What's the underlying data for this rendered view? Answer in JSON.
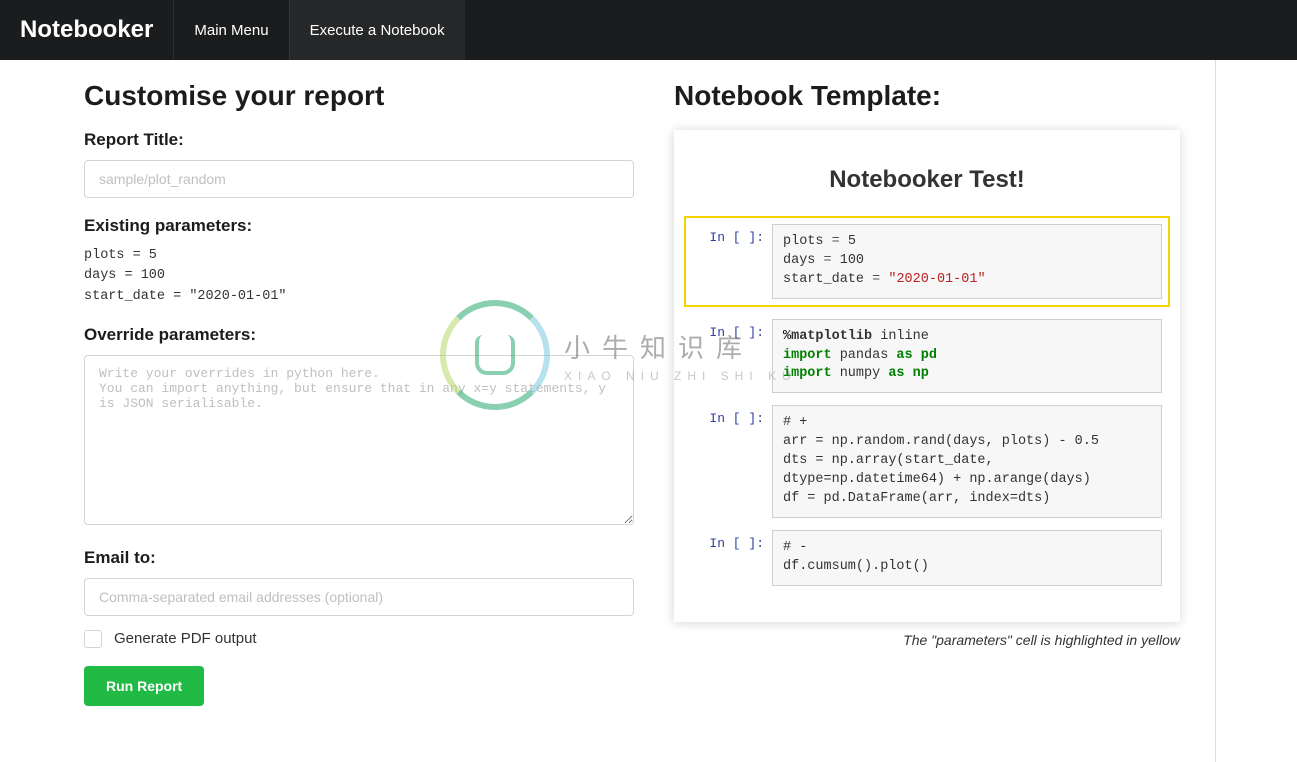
{
  "nav": {
    "brand": "Notebooker",
    "main_menu": "Main Menu",
    "execute": "Execute a Notebook"
  },
  "left": {
    "heading": "Customise your report",
    "report_title_label": "Report Title:",
    "report_title_placeholder": "sample/plot_random",
    "existing_params_label": "Existing parameters:",
    "existing_params": "plots = 5\ndays = 100\nstart_date = \"2020-01-01\"",
    "override_label": "Override parameters:",
    "override_placeholder": "Write your overrides in python here.\nYou can import anything, but ensure that in any x=y statements, y is JSON serialisable.",
    "email_label": "Email to:",
    "email_placeholder": "Comma-separated email addresses (optional)",
    "pdf_label": "Generate PDF output",
    "run_button": "Run Report"
  },
  "right": {
    "heading": "Notebook Template:",
    "notebook_title": "Notebooker Test!",
    "prompt": "In [ ]:",
    "cell1": {
      "l1a": "plots ",
      "l1b": "=",
      "l1c": " 5",
      "l2a": "days ",
      "l2b": "=",
      "l2c": " 100",
      "l3a": "start_date ",
      "l3b": "=",
      "l3c": " ",
      "l3d": "\"2020-01-01\""
    },
    "cell2": {
      "l1a": "%",
      "l1b": "matplotlib",
      "l1c": " inline",
      "l2a": "import",
      "l2b": " pandas ",
      "l2c": "as",
      "l2d": " pd",
      "l3a": "import",
      "l3b": " numpy ",
      "l3c": "as",
      "l3d": " np"
    },
    "cell3": "# +\narr = np.random.rand(days, plots) - 0.5\ndts = np.array(start_date, dtype=np.datetime64) + np.arange(days)\ndf = pd.DataFrame(arr, index=dts)",
    "cell4": "# -\ndf.cumsum().plot()",
    "caption": "The \"parameters\" cell is highlighted in yellow"
  },
  "watermark": {
    "cn": "小牛知识库",
    "en": "XIAO NIU ZHI SHI KU"
  }
}
